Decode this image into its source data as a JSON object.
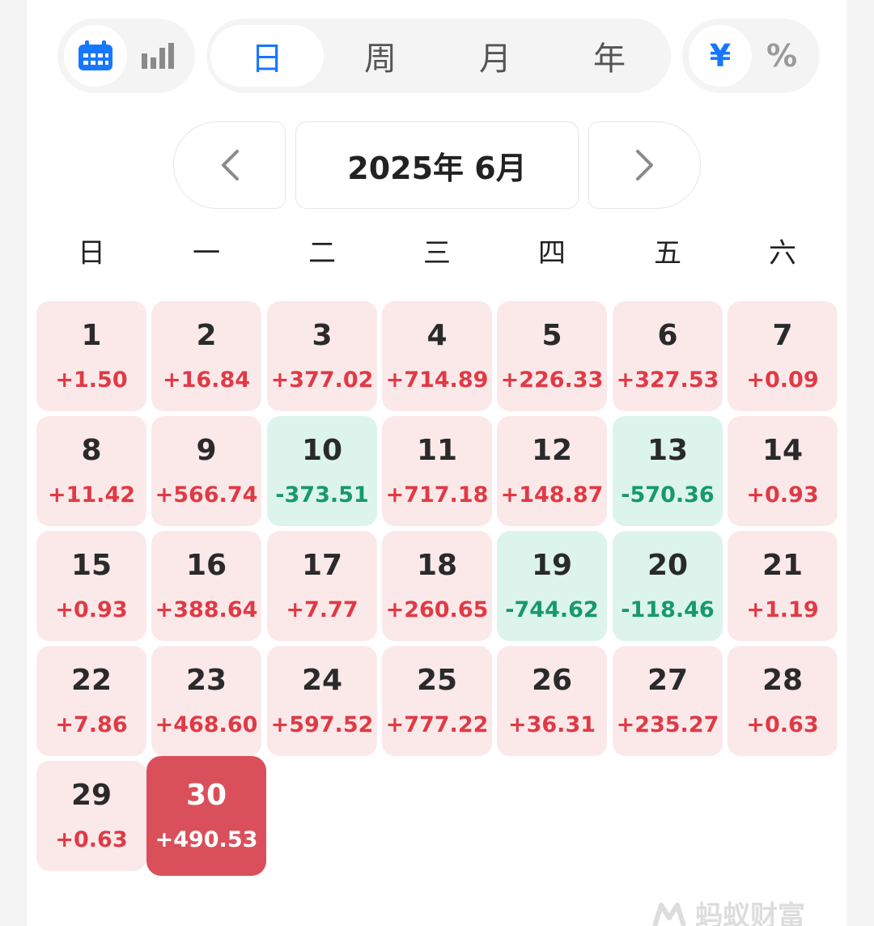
{
  "toolbar": {
    "view_icons": [
      "calendar-icon",
      "bar-chart-icon"
    ],
    "periods": [
      "日",
      "周",
      "月",
      "年"
    ],
    "active_period": "日",
    "units": [
      "¥",
      "%"
    ],
    "active_unit": "¥"
  },
  "navigation": {
    "prev_label": "‹",
    "month_label": "2025年 6月",
    "next_label": "›"
  },
  "weekdays": [
    "日",
    "一",
    "二",
    "三",
    "四",
    "五",
    "六"
  ],
  "colors": {
    "accent": "#1677ff",
    "profit_text": "#e03a45",
    "profit_bg": "#fbe9ea",
    "loss_text": "#17996b",
    "loss_bg": "#dcf4ec",
    "selected_bg": "#d9505b"
  },
  "days": [
    {
      "d": "1",
      "v": "+1.50"
    },
    {
      "d": "2",
      "v": "+16.84"
    },
    {
      "d": "3",
      "v": "+377.02"
    },
    {
      "d": "4",
      "v": "+714.89"
    },
    {
      "d": "5",
      "v": "+226.33"
    },
    {
      "d": "6",
      "v": "+327.53"
    },
    {
      "d": "7",
      "v": "+0.09"
    },
    {
      "d": "8",
      "v": "+11.42"
    },
    {
      "d": "9",
      "v": "+566.74"
    },
    {
      "d": "10",
      "v": "-373.51"
    },
    {
      "d": "11",
      "v": "+717.18"
    },
    {
      "d": "12",
      "v": "+148.87"
    },
    {
      "d": "13",
      "v": "-570.36"
    },
    {
      "d": "14",
      "v": "+0.93"
    },
    {
      "d": "15",
      "v": "+0.93"
    },
    {
      "d": "16",
      "v": "+388.64"
    },
    {
      "d": "17",
      "v": "+7.77"
    },
    {
      "d": "18",
      "v": "+260.65"
    },
    {
      "d": "19",
      "v": "-744.62"
    },
    {
      "d": "20",
      "v": "-118.46"
    },
    {
      "d": "21",
      "v": "+1.19"
    },
    {
      "d": "22",
      "v": "+7.86"
    },
    {
      "d": "23",
      "v": "+468.60"
    },
    {
      "d": "24",
      "v": "+597.52"
    },
    {
      "d": "25",
      "v": "+777.22"
    },
    {
      "d": "26",
      "v": "+36.31"
    },
    {
      "d": "27",
      "v": "+235.27"
    },
    {
      "d": "28",
      "v": "+0.63"
    },
    {
      "d": "29",
      "v": "+0.63"
    },
    {
      "d": "30",
      "v": "+490.53",
      "selected": true
    }
  ],
  "watermark": {
    "text": "蚂蚁财富",
    "logo_icon": "ant-logo-icon"
  }
}
